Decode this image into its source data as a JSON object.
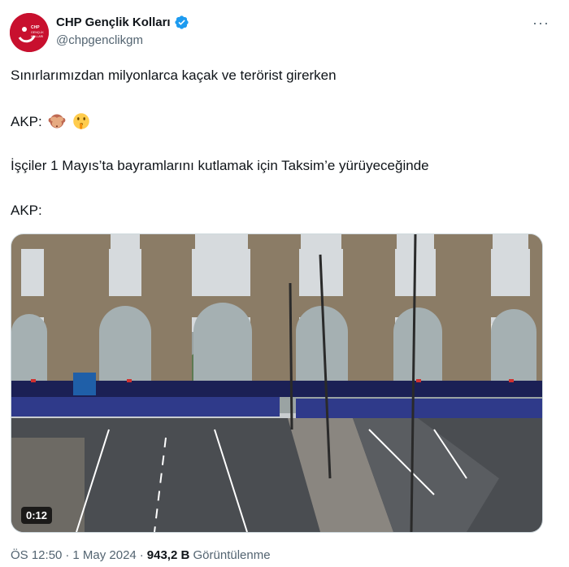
{
  "author": {
    "display_name": "CHP Gençlik Kolları",
    "handle": "@chpgenclikgm",
    "avatar_text": "CHP GENÇLİK KOLLARI",
    "brand_color": "#c8102e",
    "verified_color": "#1d9bf0"
  },
  "more_label": "···",
  "tweet": {
    "line1": "Sınırlarımızdan milyonlarca kaçak ve terörist girerken",
    "line2_prefix": "AKP:",
    "line2_emojis": [
      "see-no-evil-monkey-icon",
      "shushing-face-icon"
    ],
    "line3": "İşçiler 1 Mayıs’ta bayramlarını kutlamak için Taksim’e yürüyeceğinde",
    "line4_prefix": "AKP:"
  },
  "media": {
    "type": "video",
    "duration": "0:12"
  },
  "meta": {
    "time": "ÖS 12:50",
    "date": "1 May 2024",
    "views_count": "943,2 B",
    "views_label": "Görüntülenme",
    "separator": "·"
  }
}
